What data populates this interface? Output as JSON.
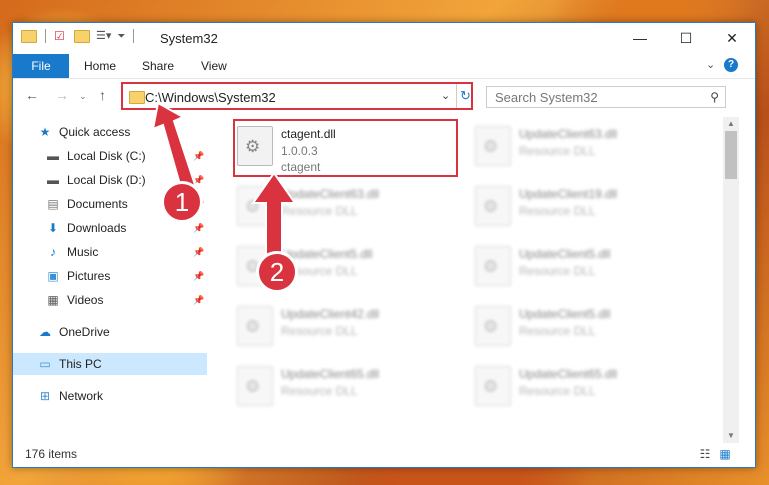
{
  "window": {
    "title": "System32",
    "minimize": "—",
    "maximize": "☐",
    "close": "✕"
  },
  "ribbon": {
    "file": "File",
    "home": "Home",
    "share": "Share",
    "view": "View"
  },
  "address": {
    "path": "C:\\Windows\\System32",
    "search_placeholder": "Search System32"
  },
  "sidebar": {
    "items": [
      {
        "label": "Quick access",
        "icon": "star-icon"
      },
      {
        "label": "Local Disk (C:)",
        "icon": "drive-icon"
      },
      {
        "label": "Local Disk (D:)",
        "icon": "drive-icon"
      },
      {
        "label": "Documents",
        "icon": "documents-icon"
      },
      {
        "label": "Downloads",
        "icon": "download-icon"
      },
      {
        "label": "Music",
        "icon": "music-icon"
      },
      {
        "label": "Pictures",
        "icon": "pictures-icon"
      },
      {
        "label": "Videos",
        "icon": "videos-icon"
      },
      {
        "label": "OneDrive",
        "icon": "cloud-icon"
      },
      {
        "label": "This PC",
        "icon": "computer-icon"
      },
      {
        "label": "Network",
        "icon": "network-icon"
      }
    ]
  },
  "files": {
    "featured": {
      "name": "ctagent.dll",
      "version": "1.0.0.3",
      "desc": "ctagent"
    },
    "left": [
      {
        "name": "UpdateClient63.dll",
        "desc": "Resource DLL"
      },
      {
        "name": "UpdateClient5.dll",
        "desc": "Resource DLL"
      },
      {
        "name": "UpdateClient42.dll",
        "desc": "Resource DLL"
      },
      {
        "name": "UpdateClient65.dll",
        "desc": "Resource DLL"
      }
    ],
    "right": [
      {
        "name": "UpdateClient63.dll",
        "desc": "Resource DLL"
      },
      {
        "name": "UpdateClient19.dll",
        "desc": "Resource DLL"
      },
      {
        "name": "UpdateClient5.dll",
        "desc": "Resource DLL"
      },
      {
        "name": "UpdateClient5.dll",
        "desc": "Resource DLL"
      },
      {
        "name": "UpdateClient65.dll",
        "desc": "Resource DLL"
      }
    ]
  },
  "status": {
    "count": "176 items"
  },
  "callouts": {
    "one": "1",
    "two": "2"
  },
  "colors": {
    "accent": "#1979ca",
    "highlight": "#d9333f"
  }
}
